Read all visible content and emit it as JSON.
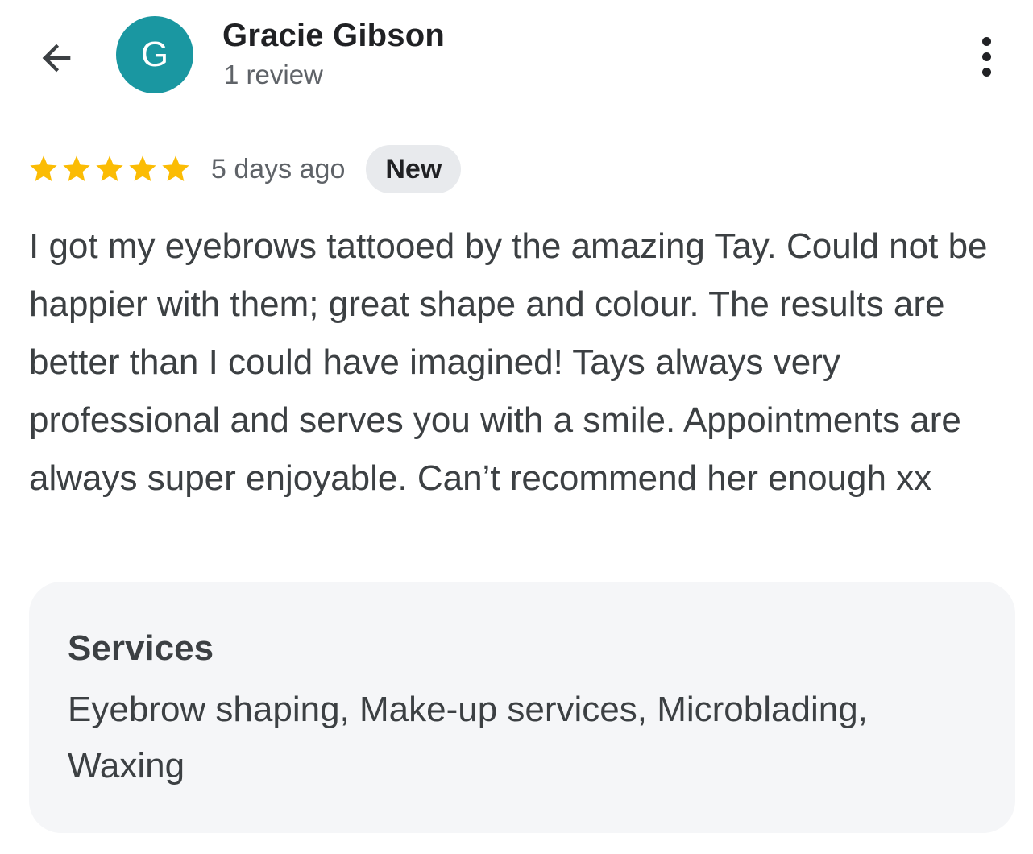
{
  "header": {
    "back_icon": "arrow-back-icon",
    "avatar": {
      "initial": "G",
      "color": "#1a97a1"
    },
    "reviewer_name": "Gracie Gibson",
    "review_count": "1 review",
    "more_icon": "more-vertical-icon"
  },
  "review": {
    "rating": 5,
    "rating_max": 5,
    "star_color": "#fbbc04",
    "star_icon": "star-icon",
    "date": "5 days ago",
    "badge": "New",
    "text": "I got my eyebrows tattooed by the amazing Tay. Could not be happier with them; great shape and colour. The results are better than I could have imagined! Tays always very professional and serves you with a smile. Appointments are always super enjoyable. Can’t recommend her enough xx"
  },
  "services": {
    "title": "Services",
    "list": "Eyebrow shaping, Make-up services, Microblading, Waxing"
  }
}
